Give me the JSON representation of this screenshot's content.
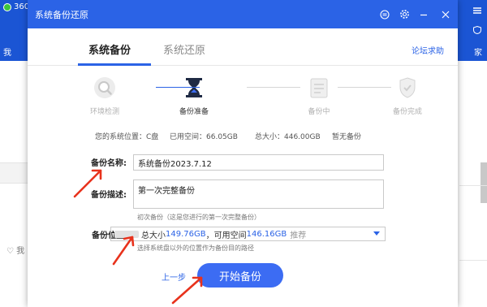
{
  "background_app": {
    "title": "360",
    "nav_left": "我",
    "nav_right": "家",
    "like": "♡  我"
  },
  "dialog": {
    "title": "系统备份还原",
    "titlebar_icons": [
      "skin-icon",
      "gear-icon",
      "minimize-icon",
      "close-icon"
    ],
    "tabs": [
      {
        "label": "系统备份",
        "active": true
      },
      {
        "label": "系统还原",
        "active": false
      }
    ],
    "help_link": "论坛求助",
    "steps": [
      {
        "label": "环境检测",
        "icon": "magnifier-icon",
        "active": false
      },
      {
        "label": "备份准备",
        "icon": "hourglass-icon",
        "active": true
      },
      {
        "label": "备份中",
        "icon": "document-icon",
        "active": false
      },
      {
        "label": "备份完成",
        "icon": "checkmark-icon",
        "active": false
      }
    ],
    "info": {
      "system_location": "您的系统位置：C盘",
      "used_space": "已用空间：66.05GB",
      "total_size": "总大小：446.00GB",
      "backup_status": "暂无备份"
    },
    "form": {
      "name_label": "备份名称:",
      "name_value": "系统备份2023.7.12",
      "desc_label": "备份描述:",
      "desc_value": "第一次完整备份",
      "desc_hint": "初次备份（这是您进行的第一次完整备份）",
      "location_label": "备份位置:",
      "location_total_prefix": "总大小",
      "location_total": "149.76GB",
      "location_sep": "，可用空间",
      "location_free": "146.16GB",
      "location_tag": "推荐",
      "location_hint": "选择系统盘以外的位置作为备份目的路径"
    },
    "actions": {
      "prev": "上一步",
      "start": "开始备份"
    },
    "accent_color": "#2b63e6",
    "arrow_color": "#e8321c"
  }
}
